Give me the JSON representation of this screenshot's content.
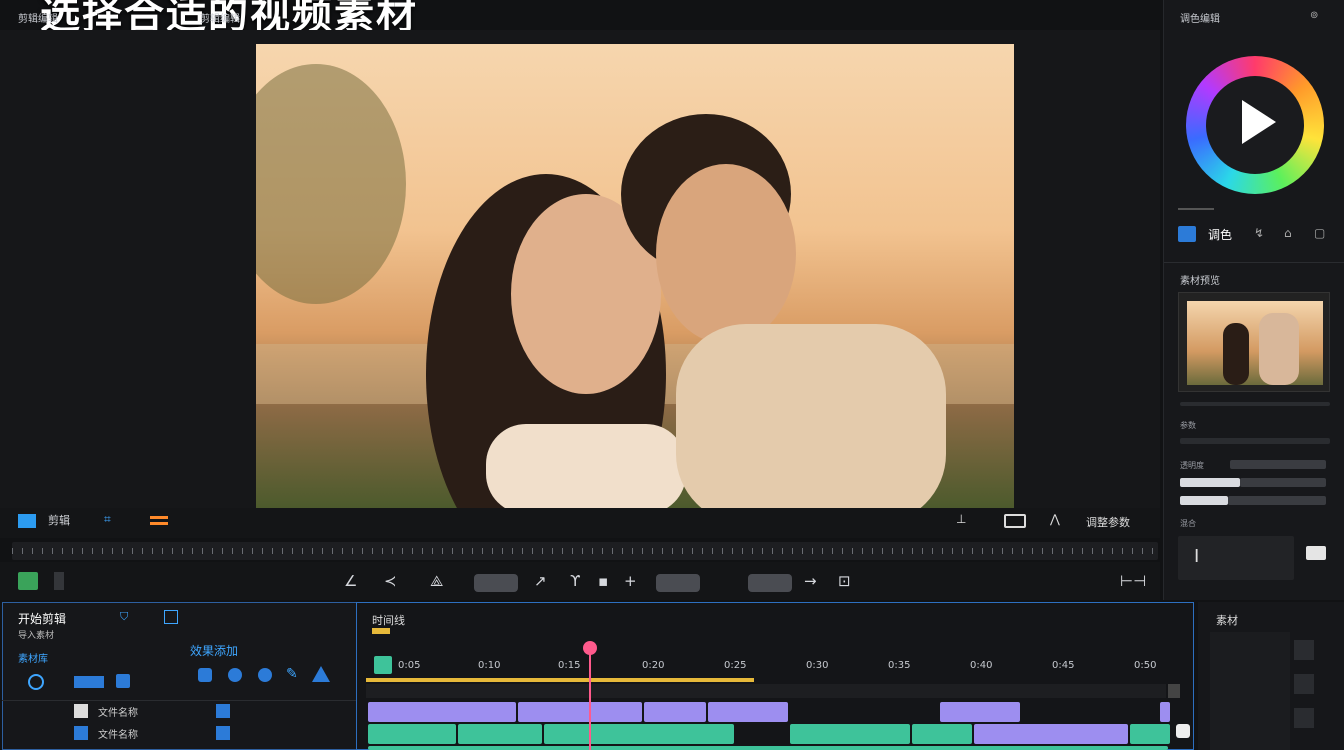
{
  "banner_text": "选择合适的视频素材",
  "top_labels": [
    "剪辑编辑",
    "剪辑编辑"
  ],
  "right_panel": {
    "title": "调色编辑",
    "tab_label": "调色",
    "preview_title": "素材预览",
    "rows": [
      "参数",
      "透明度",
      "混合"
    ]
  },
  "controls": {
    "menu_label": "剪辑",
    "right_label": "调整参数"
  },
  "bottom_left": {
    "title": "开始剪辑",
    "subtitle": "导入素材",
    "tabs_label": "素材库",
    "tool_label": "效果添加",
    "rows": [
      {
        "label": "文件名称"
      },
      {
        "label": "文件名称"
      }
    ]
  },
  "timeline": {
    "title": "时间线",
    "ticks": [
      "0:05",
      "0:10",
      "0:15",
      "0:20",
      "0:25",
      "0:30",
      "0:35",
      "0:40",
      "0:45",
      "0:50"
    ]
  },
  "bottom_right": {
    "title": "素材"
  }
}
